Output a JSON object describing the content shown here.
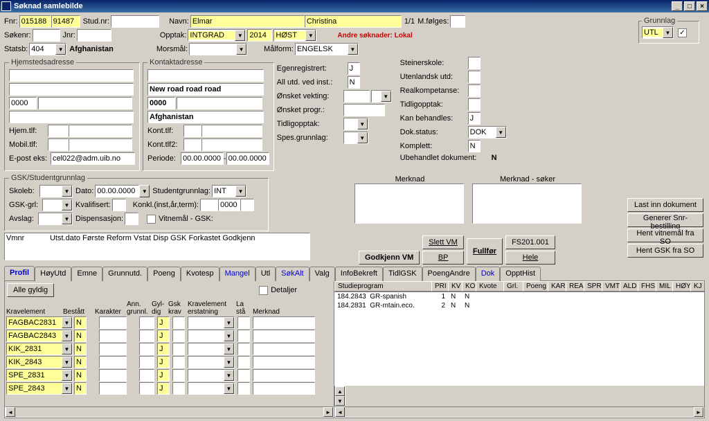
{
  "window_title": "Søknad samlebilde",
  "top": {
    "fnr_label": "Fnr:",
    "fnr1": "015188",
    "fnr2": "91487",
    "studnr_label": "Stud.nr:",
    "navn_label": "Navn:",
    "navn1": "Elmar",
    "navn2": "Christina",
    "count": "1/1",
    "mfolges_label": "M.følges:",
    "sokenr_label": "Søkenr:",
    "jnr_label": "Jnr:",
    "opptak_label": "Opptak:",
    "opptak1": "INTGRAD",
    "opptak2": "2014",
    "opptak3": "HØST",
    "andre_sok": "Andre søknader: Lokal",
    "statsb_label": "Statsb:",
    "statsb_val": "404",
    "statsb_land": "Afghanistan",
    "morsmal_label": "Morsmål:",
    "malform_label": "Målform:",
    "malform_val": "ENGELSK",
    "grunnlag_label": "Grunnlag",
    "grunnlag_val": "UTL"
  },
  "hjem": {
    "legend": "Hjemstedsadresse",
    "post": "0000",
    "hjemtlf_label": "Hjem.tlf:",
    "mobiltlf_label": "Mobil.tlf:",
    "epost_label": "E-post eks:",
    "epost_val": "cel022@adm.uib.no"
  },
  "kontakt": {
    "legend": "Kontaktadresse",
    "gate": "New road road road",
    "post": "0000",
    "land": "Afghanistan",
    "konttlf_label": "Kont.tlf:",
    "konttlf2_label": "Kont.tlf2:",
    "periode_label": "Periode:",
    "periode_fra": "00.00.0000",
    "periode_til": "00.00.0000"
  },
  "right_flags": {
    "egenreg_label": "Egenregistrert:",
    "egenreg": "J",
    "allutd_label": "All utd. ved inst.:",
    "allutd": "N",
    "onsketv_label": "Ønsket vekting:",
    "onsketp_label": "Ønsket progr.:",
    "tidligopp_label": "Tidligopptak:",
    "spesgrl_label": "Spes.grunnlag:",
    "steiner_label": "Steinerskole:",
    "utenlandsk_label": "Utenlandsk utd:",
    "realkomp_label": "Realkompetanse:",
    "tidligopp2_label": "Tidligopptak:",
    "kanbeh_label": "Kan behandles:",
    "kanbeh": "J",
    "dokstatus_label": "Dok.status:",
    "dokstatus": "DOK",
    "komplett_label": "Komplett:",
    "komplett": "N",
    "ubeh_label": "Ubehandlet dokument:",
    "ubeh": "N"
  },
  "gsk": {
    "legend": "GSK/Studentgrunnlag",
    "skoleb_label": "Skoleb:",
    "dato_label": "Dato:",
    "dato_val": "00.00.0000",
    "studgrl_label": "Studentgrunnlag:",
    "studgrl_val": "INT",
    "gskgrl_label": "GSK-grl:",
    "kvalifisert_label": "Kvalifisert:",
    "konkl_label": "Konkl.(inst,år,term):",
    "konkl_num": "0000",
    "avslag_label": "Avslag:",
    "disp_label": "Dispensasjon:",
    "vitnemal_chk_label": "Vitnemål - GSK:"
  },
  "vmnr_header": "Vmnr            Utst.dato Første Reform Vstat Disp GSK Forkastet Godkjenn",
  "merknad_label": "Merknad",
  "merknad_soker_label": "Merknad - søker",
  "buttons": {
    "godkjenn_vm": "Godkjenn VM",
    "slett_vm": "Slett VM",
    "bp": "BP",
    "fullfor": "Fullfør",
    "fs201": "FS201.001",
    "hele": "Hele",
    "lastinn": "Last inn dokument",
    "genererSnr": "Generer Snr-bestilling",
    "hentVM": "Hent vitnemål fra SO",
    "hentGSK": "Hent GSK fra SO"
  },
  "tabs": [
    "Profil",
    "HøyUtd",
    "Emne",
    "Grunnutd.",
    "Poeng",
    "Kvotesp",
    "Mangel",
    "Utl",
    "SøkAlt",
    "Valg",
    "InfoBekreft",
    "TidlGSK",
    "PoengAndre",
    "Dok",
    "OpptHist"
  ],
  "tab_blue": {
    "Profil": true,
    "Mangel": true,
    "SøkAlt": true,
    "Dok": true
  },
  "alle_gyldig": "Alle gyldig",
  "detaljer_label": "Detaljer",
  "left_grid": {
    "headers": {
      "kravelem": "Kravelement",
      "bestatt": "Bestått",
      "karakter": "Karakter",
      "ann": "Ann.\ngrunnl.",
      "gyl": "Gyl-\ndig",
      "gsk": "Gsk\nkrav",
      "kravelem2": "Kravelement\nerstatning",
      "lasta": "La\nstå",
      "merknad": "Merknad"
    },
    "rows": [
      {
        "code": "FAGBAC2831",
        "bestatt": "N",
        "gyl": "J"
      },
      {
        "code": "FAGBAC2843",
        "bestatt": "N",
        "gyl": "J"
      },
      {
        "code": "KIK_2831",
        "bestatt": "N",
        "gyl": "J"
      },
      {
        "code": "KIK_2843",
        "bestatt": "N",
        "gyl": "J"
      },
      {
        "code": "SPE_2831",
        "bestatt": "N",
        "gyl": "J"
      },
      {
        "code": "SPE_2843",
        "bestatt": "N",
        "gyl": "J"
      }
    ]
  },
  "right_grid": {
    "headers": [
      "Studieprogram",
      "PRI",
      "KV",
      "KO",
      "Kvote",
      "Grl.",
      "Poeng",
      "KAR",
      "REA",
      "SPR",
      "VMT",
      "ALD",
      "FHS",
      "MIL",
      "HØY",
      "KJ"
    ],
    "rows": [
      {
        "code": "184.2843",
        "name": "GR-spanish",
        "pri": "1",
        "kv": "N",
        "ko": "N"
      },
      {
        "code": "184.2831",
        "name": "GR-mtain.eco.",
        "pri": "2",
        "kv": "N",
        "ko": "N"
      }
    ]
  }
}
